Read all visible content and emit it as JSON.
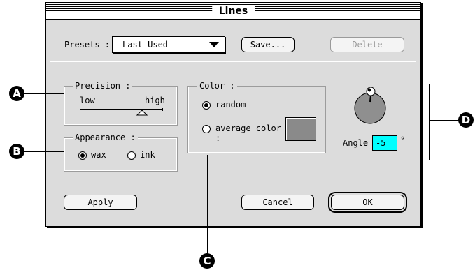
{
  "window": {
    "title": "Lines"
  },
  "presets": {
    "label": "Presets :",
    "value": "Last Used",
    "save_label": "Save...",
    "delete_label": "Delete"
  },
  "precision": {
    "legend": "Precision :",
    "low_label": "low",
    "high_label": "high",
    "value": 0.75
  },
  "appearance": {
    "legend": "Appearance :",
    "options": [
      "wax",
      "ink"
    ],
    "selected": "wax"
  },
  "color": {
    "legend": "Color :",
    "options": [
      "random",
      "average color :"
    ],
    "selected": "random",
    "swatch": "#8a8a8a"
  },
  "angle": {
    "label": "Angle :",
    "value": "-5",
    "unit": "°"
  },
  "buttons": {
    "apply": "Apply",
    "cancel": "Cancel",
    "ok": "OK"
  },
  "callouts": [
    "A",
    "B",
    "C",
    "D"
  ],
  "colors": {
    "dialog_bg": "#dcdcdc",
    "angle_field_bg": "#00ffff",
    "dial": "#8f8f8f"
  }
}
